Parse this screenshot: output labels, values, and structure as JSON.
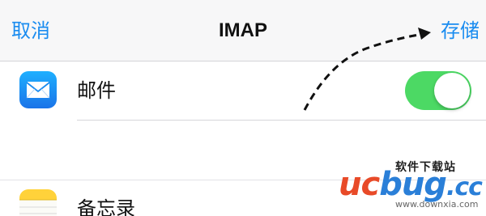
{
  "nav": {
    "cancel_label": "取消",
    "title": "IMAP",
    "save_label": "存储"
  },
  "rows": [
    {
      "label": "邮件",
      "icon": "mail-icon",
      "toggle_on": true
    },
    {
      "label": "备忘录",
      "icon": "notes-icon"
    }
  ],
  "colors": {
    "accent": "#1a8cf0",
    "toggle_on": "#4cd964",
    "mail_icon": "#1a8cf0",
    "notes_icon": "#ffd23a"
  },
  "watermark": {
    "site_name": "软件下载站",
    "logo_uc": "uc",
    "logo_bug": "bug",
    "logo_suffix": ".cc",
    "url": "www.downxia.com"
  }
}
